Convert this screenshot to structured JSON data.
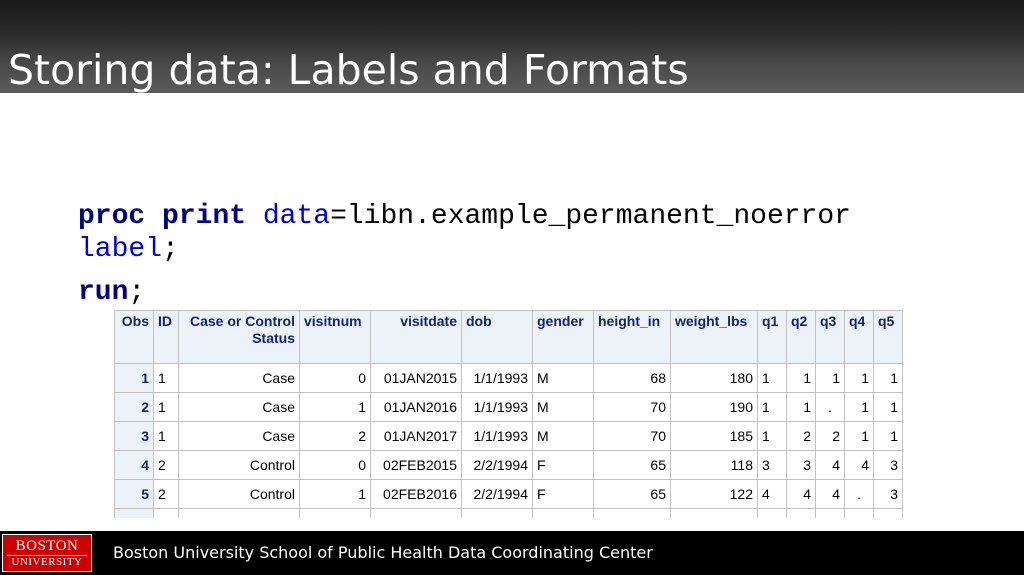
{
  "slide": {
    "title": "Storing data: Labels and Formats"
  },
  "code": {
    "line1": {
      "kw_proc": "proc",
      "kw_print": "print",
      "opt_data": "data",
      "rest": "=libn.example_permanent_noerror"
    },
    "line2": {
      "opt_label": "label",
      "semicolon": ";"
    },
    "line3": {
      "kw_run": "run",
      "semicolon": ";"
    }
  },
  "output_table": {
    "headers": [
      "Obs",
      "ID",
      "Case or Control Status",
      "visitnum",
      "visitdate",
      "dob",
      "gender",
      "height_in",
      "weight_lbs",
      "q1",
      "q2",
      "q3",
      "q4",
      "q5"
    ],
    "rows": [
      [
        "1",
        "1",
        "Case",
        "0",
        "01JAN2015",
        "1/1/1993",
        "M",
        "68",
        "180",
        "1",
        "1",
        "1",
        "1",
        "1"
      ],
      [
        "2",
        "1",
        "Case",
        "1",
        "01JAN2016",
        "1/1/1993",
        "M",
        "70",
        "190",
        "1",
        "1",
        ".",
        "1",
        "1"
      ],
      [
        "3",
        "1",
        "Case",
        "2",
        "01JAN2017",
        "1/1/1993",
        "M",
        "70",
        "185",
        "1",
        "2",
        "2",
        "1",
        "1"
      ],
      [
        "4",
        "2",
        "Control",
        "0",
        "02FEB2015",
        "2/2/1994",
        "F",
        "65",
        "118",
        "3",
        "3",
        "4",
        "4",
        "3"
      ],
      [
        "5",
        "2",
        "Control",
        "1",
        "02FEB2016",
        "2/2/1994",
        "F",
        "65",
        "122",
        "4",
        "4",
        "4",
        ".",
        "3"
      ]
    ]
  },
  "footer": {
    "logo_line1": "BOSTON",
    "logo_line2": "UNIVERSITY",
    "text": "Boston University School of Public Health Data Coordinating Center"
  },
  "colors": {
    "title_text": "#ffffff",
    "footer_bg": "#000000",
    "logo_red": "#cc0000",
    "keyword": "#000080",
    "option": "#0000cc",
    "table_header_bg": "#edf2f9",
    "table_header_text": "#112277"
  }
}
